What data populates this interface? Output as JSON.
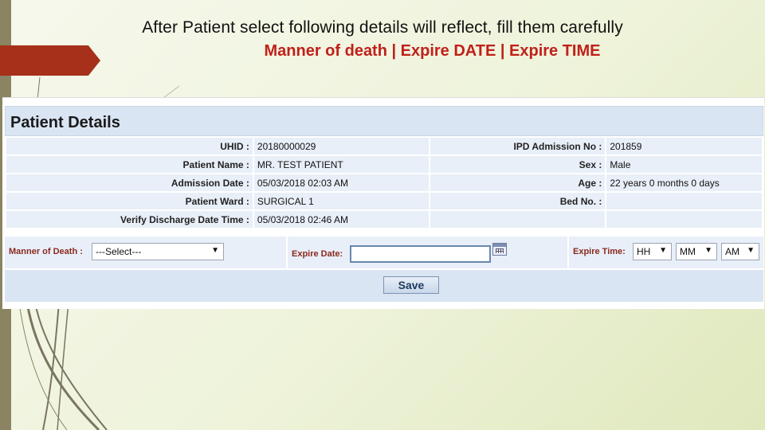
{
  "slide": {
    "title": "After Patient select following details will reflect, fill them carefully",
    "subtitle": "Manner of death  |  Expire DATE | Expire TIME"
  },
  "panel": {
    "title": "Patient Details",
    "rows": [
      {
        "left_label": "UHID :",
        "left_value": "20180000029",
        "right_label": "IPD Admission No :",
        "right_value": "201859"
      },
      {
        "left_label": "Patient Name :",
        "left_value": "MR. TEST PATIENT",
        "right_label": "Sex :",
        "right_value": "Male"
      },
      {
        "left_label": "Admission Date :",
        "left_value": "05/03/2018 02:03 AM",
        "right_label": "Age :",
        "right_value": "22 years 0 months 0 days"
      },
      {
        "left_label": "Patient Ward :",
        "left_value": "SURGICAL 1",
        "right_label": "Bed No. :",
        "right_value": ""
      },
      {
        "left_label": "Verify Discharge Date Time :",
        "left_value": "05/03/2018 02:46 AM",
        "right_label": "",
        "right_value": ""
      }
    ]
  },
  "form": {
    "manner_label": "Manner of Death :",
    "manner_value": "---Select---",
    "expire_date_label": "Expire Date:",
    "expire_date_value": "",
    "expire_time_label": "Expire Time:",
    "hh": "HH",
    "mm": "MM",
    "ampm": "AM",
    "save_label": "Save"
  },
  "icons": {
    "dropdown": "caret-down-icon",
    "calendar": "calendar-icon"
  },
  "colors": {
    "subtitle": "#c0201a",
    "form_label": "#8b2a1f",
    "accent_bar": "#a6301a",
    "panel_bg": "#d9e5f3"
  }
}
